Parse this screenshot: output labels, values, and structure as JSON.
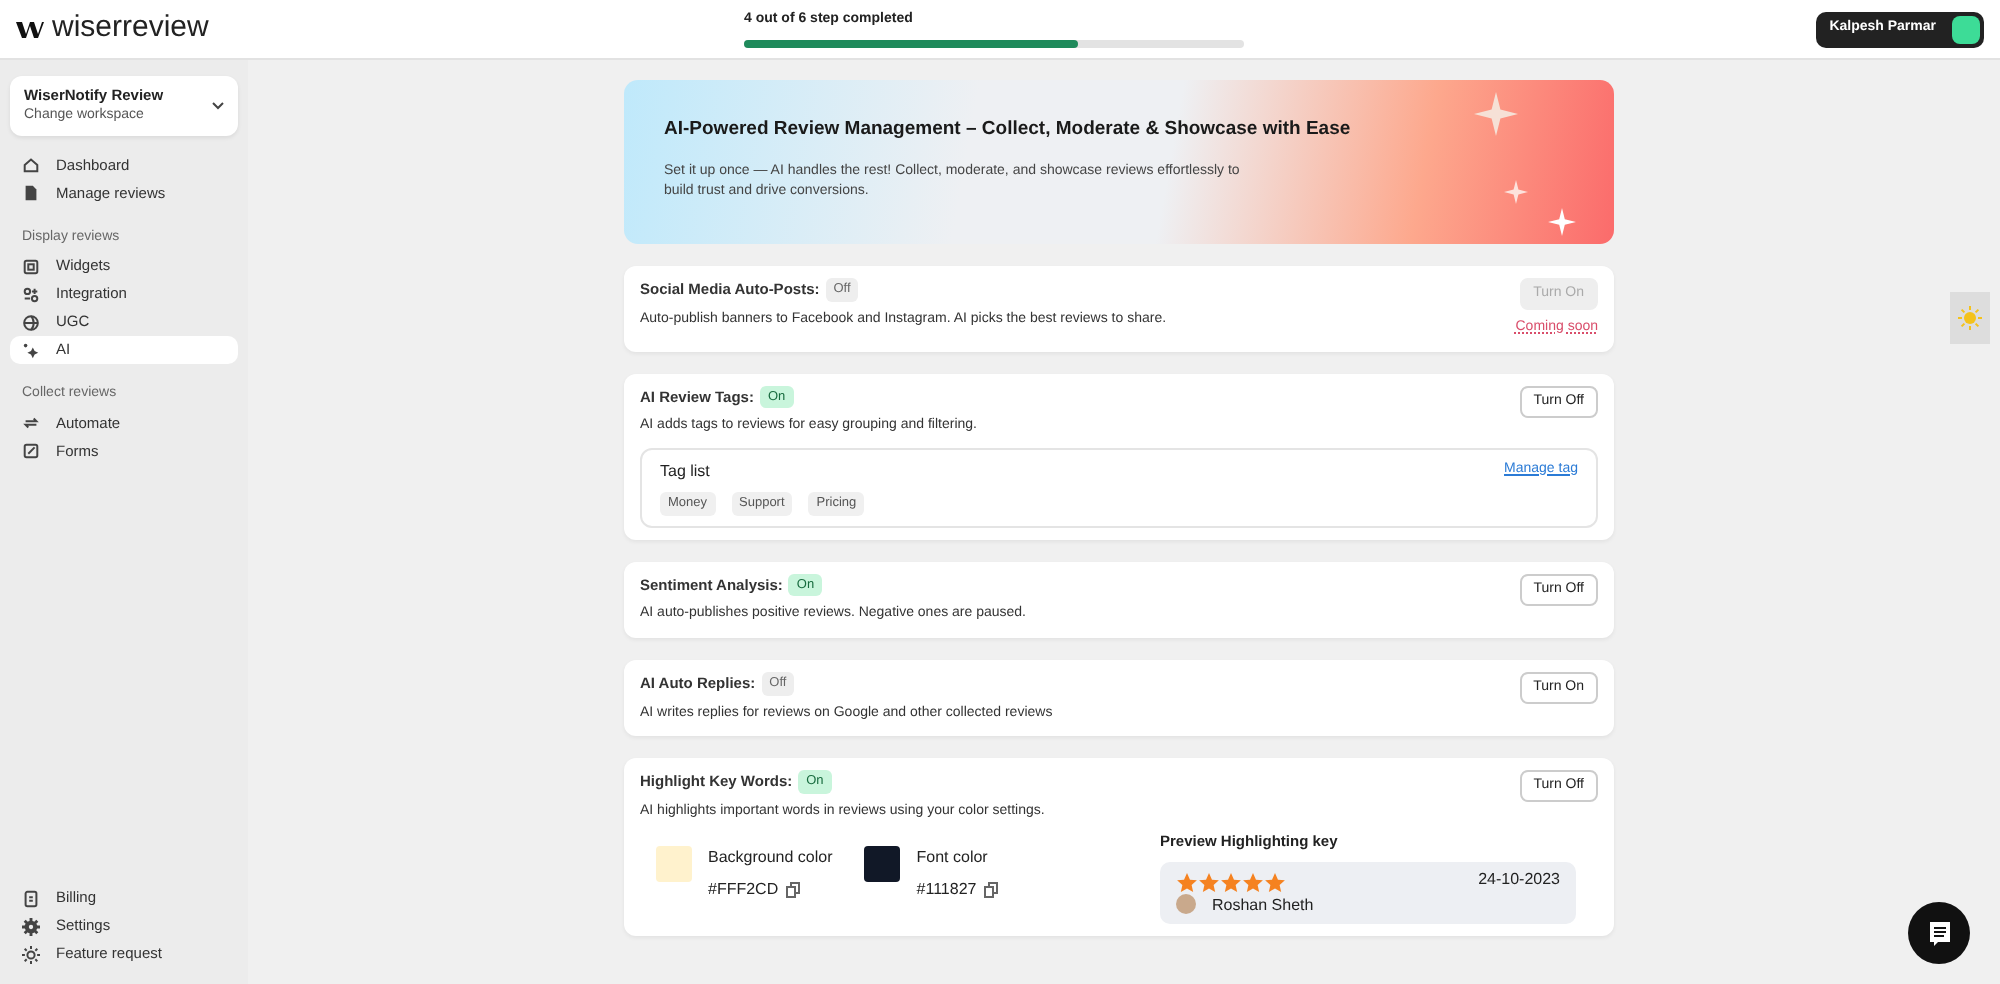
{
  "brand": "wiserreview",
  "progress": {
    "label": "4 out of 6 step completed",
    "level": 0.667
  },
  "user": {
    "name": "Kalpesh Parmar"
  },
  "workspace": {
    "name": "WiserNotify Review",
    "subtitle": "Change workspace"
  },
  "sidebar": {
    "groups": [
      {
        "items": [
          {
            "label": "Dashboard",
            "kind": "home",
            "selected": false
          },
          {
            "label": "Manage reviews",
            "kind": "file",
            "selected": false
          }
        ]
      },
      {
        "heading": "Display reviews",
        "items": [
          {
            "label": "Widgets",
            "kind": "widget",
            "selected": false
          },
          {
            "label": "Integration",
            "kind": "integration",
            "selected": false
          },
          {
            "label": "UGC",
            "kind": "ugc",
            "selected": false
          },
          {
            "label": "AI",
            "kind": "ai",
            "selected": true
          }
        ]
      },
      {
        "heading": "Collect reviews",
        "items": [
          {
            "label": "Automate",
            "kind": "repeat",
            "selected": false
          },
          {
            "label": "Forms",
            "kind": "form",
            "selected": false
          }
        ]
      }
    ],
    "footer_items": [
      {
        "label": "Billing",
        "kind": "billing",
        "selected": false
      },
      {
        "label": "Settings",
        "kind": "gear",
        "selected": false
      },
      {
        "label": "Feature request",
        "kind": "sun",
        "selected": false
      }
    ]
  },
  "banner": {
    "title": "AI-Powered Review Management – Collect, Moderate & Showcase with Ease",
    "text": "Set it up once — AI handles the rest! Collect, moderate, and showcase reviews effortlessly to build trust and drive conversions."
  },
  "features": [
    {
      "title": "Social Media Auto-Posts:",
      "status": "Off",
      "on": false,
      "description": "Auto-publish banners to Facebook and Instagram. AI picks the best reviews to share.",
      "button": "Turn On",
      "disabled": true,
      "note": "Coming soon"
    },
    {
      "title": "AI Review Tags:",
      "status": "On",
      "on": true,
      "description": "AI adds tags to reviews for easy grouping and filtering.",
      "button": "Turn Off",
      "disabled": false,
      "tag_panel": {
        "title": "Tag list",
        "link": "Manage tag",
        "tags": [
          "Money",
          "Support",
          "Pricing"
        ]
      }
    },
    {
      "title": "Sentiment Analysis:",
      "status": "On",
      "on": true,
      "description": "AI auto-publishes positive reviews. Negative ones are paused.",
      "button": "Turn Off",
      "disabled": false
    },
    {
      "title": "AI Auto Replies:",
      "status": "Off",
      "on": false,
      "description": "AI writes replies for reviews on Google and other collected reviews",
      "button": "Turn On",
      "disabled": false
    },
    {
      "title": "Highlight Key Words:",
      "status": "On",
      "on": true,
      "description": "AI highlights important words in reviews using your color settings.",
      "button": "Turn Off",
      "disabled": false,
      "colors": [
        {
          "label": "Background color",
          "value": "#FFF2CD",
          "color": "#fff2cd"
        },
        {
          "label": "Font color",
          "value": "#111827",
          "color": "#111827"
        }
      ],
      "preview": {
        "title": "Preview Highlighting key",
        "stars": 5,
        "date": "24-10-2023",
        "reviewer": "Roshan Sheth"
      }
    }
  ]
}
